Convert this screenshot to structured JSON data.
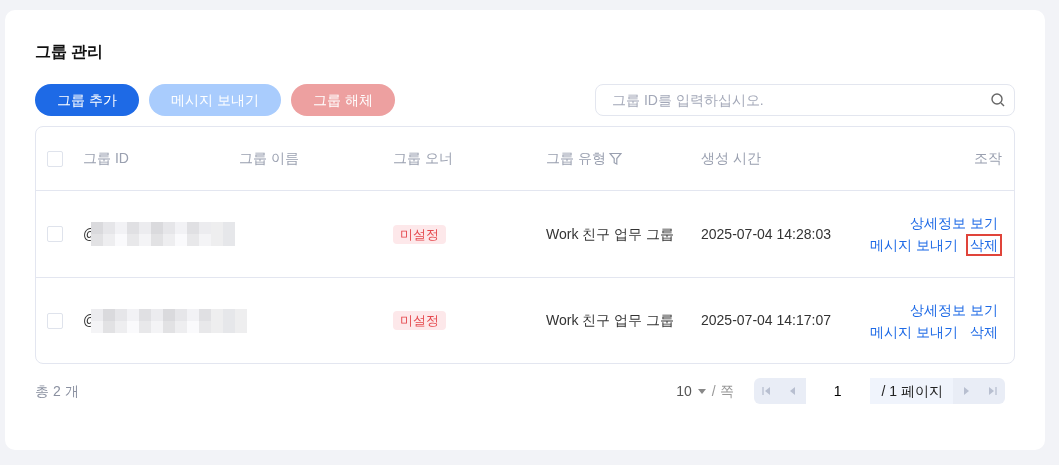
{
  "title": "그룹 관리",
  "buttons": [
    {
      "label": "그룹 추가",
      "kind": "primary",
      "disabled": false
    },
    {
      "label": "메시지 보내기",
      "kind": "primary",
      "disabled": true
    },
    {
      "label": "그룹 해체",
      "kind": "danger",
      "disabled": true
    }
  ],
  "search": {
    "placeholder": "그룹 ID를 입력하십시오."
  },
  "table": {
    "select_all": {
      "checked": false
    },
    "columns": [
      {
        "label": "그룹 ID",
        "filterable": false
      },
      {
        "label": "그룹 이름",
        "filterable": false
      },
      {
        "label": "그룹 오너",
        "filterable": false
      },
      {
        "label": "그룹 유형",
        "filterable": true
      },
      {
        "label": "생성 시간",
        "filterable": false
      },
      {
        "label": "조작",
        "filterable": false
      }
    ],
    "rows": [
      {
        "checked": false,
        "id": "@",
        "owner": "미설정",
        "type": "Work 친구 업무 그룹",
        "created": "2025-07-04 14:28:03",
        "actions": [
          {
            "label": "상세정보 보기",
            "highlighted": false
          },
          {
            "label": "메시지 보내기",
            "highlighted": false
          },
          {
            "label": "삭제",
            "highlighted": true
          }
        ]
      },
      {
        "checked": false,
        "id": "@",
        "owner": "미설정",
        "type": "Work 친구 업무 그룹",
        "created": "2025-07-04 14:17:07",
        "actions": [
          {
            "label": "상세정보 보기",
            "highlighted": false
          },
          {
            "label": "메시지 보내기",
            "highlighted": false
          },
          {
            "label": "삭제",
            "highlighted": false
          }
        ]
      }
    ]
  },
  "footer": {
    "total": "총 2 개",
    "page_size": "10",
    "per_page": "/ 쪽",
    "page": "1",
    "page_total": "/ 1 페이지"
  }
}
